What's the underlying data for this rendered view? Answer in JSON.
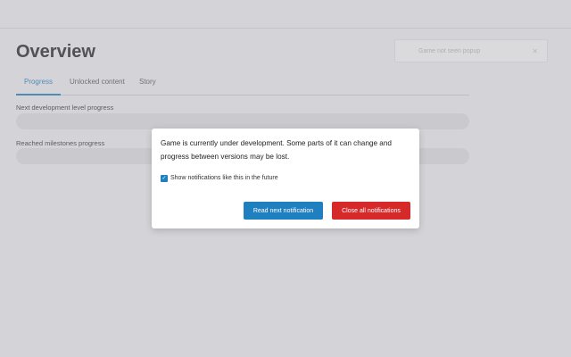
{
  "header": {
    "title": "Overview",
    "search": {
      "placeholder": "Game not seen popup",
      "clear_icon": "close-icon"
    }
  },
  "tabs": [
    {
      "label": "Progress",
      "active": true
    },
    {
      "label": "Unlocked content",
      "active": false
    },
    {
      "label": "Story",
      "active": false
    }
  ],
  "progress": [
    {
      "label": "Next development level progress",
      "value": 0
    },
    {
      "label": "Reached milestones progress",
      "value": 0
    }
  ],
  "modal": {
    "message": "Game is currently under development. Some parts of it can change and progress between versions may be lost.",
    "checkbox_label": "Show notifications like this in the future",
    "checkbox_checked": true,
    "read_next_label": "Read next notification",
    "close_all_label": "Close all notifications"
  },
  "colors": {
    "accent": "#1f7fbf",
    "danger": "#d62a2a",
    "background": "#f4f4f6",
    "overlay": "rgba(160,160,168,0.38)"
  }
}
